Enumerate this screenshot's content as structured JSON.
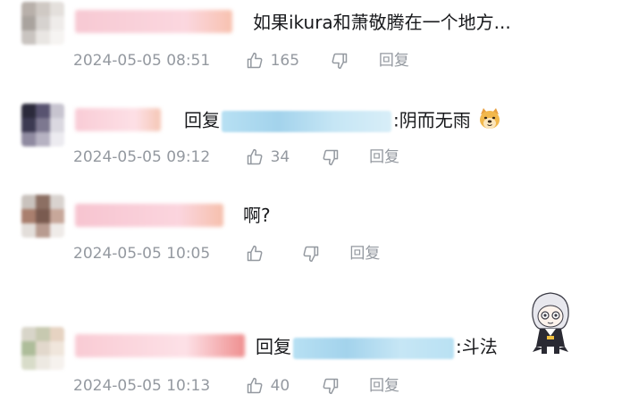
{
  "comments": [
    {
      "prefix": "",
      "text": "如果ikura和萧敬腾在一个地方...",
      "time": "2024-05-05 08:51",
      "likes": "165",
      "reply_label": "回复",
      "emoji": "",
      "emoji_label": "",
      "avatar_colors": [
        "#b8b0aa",
        "#cfc9c4",
        "#e4e0dc",
        "#a9a39e",
        "#d6d2cf",
        "#efecea",
        "#c9c4c0",
        "#e9e6e3",
        "#f6f4f2"
      ],
      "name_colors": [
        "#f7c9d3",
        "#fbd7df",
        "#f8c2b0"
      ]
    },
    {
      "prefix": "回复",
      "text": ":阴而无雨",
      "time": "2024-05-05 09:12",
      "likes": "34",
      "reply_label": "回复",
      "emoji": "🐶",
      "emoji_label": "doge-emoji",
      "avatar_colors": [
        "#2b2a3b",
        "#585370",
        "#c7c4cf",
        "#3c3a52",
        "#7d7890",
        "#dad8e0",
        "#8f8aa0",
        "#b6b2c2",
        "#ecebf0"
      ],
      "name_colors": [
        "#f9ccd6",
        "#fde0e6",
        "#f5c7b6"
      ]
    },
    {
      "prefix": "",
      "text": "啊?",
      "time": "2024-05-05 10:05",
      "likes": "",
      "reply_label": "回复",
      "emoji": "",
      "emoji_label": "",
      "avatar_colors": [
        "#c9c2bd",
        "#8c6f63",
        "#d9d3cf",
        "#a97f6e",
        "#7a5b50",
        "#c7a79a",
        "#e3deda",
        "#b89b90",
        "#efebe8"
      ],
      "name_colors": [
        "#f7c4d0",
        "#fbd5de",
        "#f6c0ad"
      ]
    },
    {
      "prefix": "回复",
      "text": ":斗法",
      "time": "2024-05-05 10:13",
      "likes": "40",
      "reply_label": "回复",
      "emoji": "",
      "emoji_label": "",
      "avatar_colors": [
        "#d8d5c9",
        "#c7c9b0",
        "#e6d3c2",
        "#aebd9a",
        "#e2d8cc",
        "#f0e6dc",
        "#d8dcc9",
        "#ede9e2",
        "#f6f2ee"
      ],
      "name_colors": [
        "#f9cbd4",
        "#fde1e7",
        "#ef8f8f"
      ]
    }
  ],
  "colors": {
    "meta_gray": "#9499a0",
    "reply_target_blue": "#a9d7ee",
    "text": "#18191c"
  },
  "icons": {
    "like": "thumbs-up-icon",
    "dislike": "thumbs-down-icon"
  }
}
